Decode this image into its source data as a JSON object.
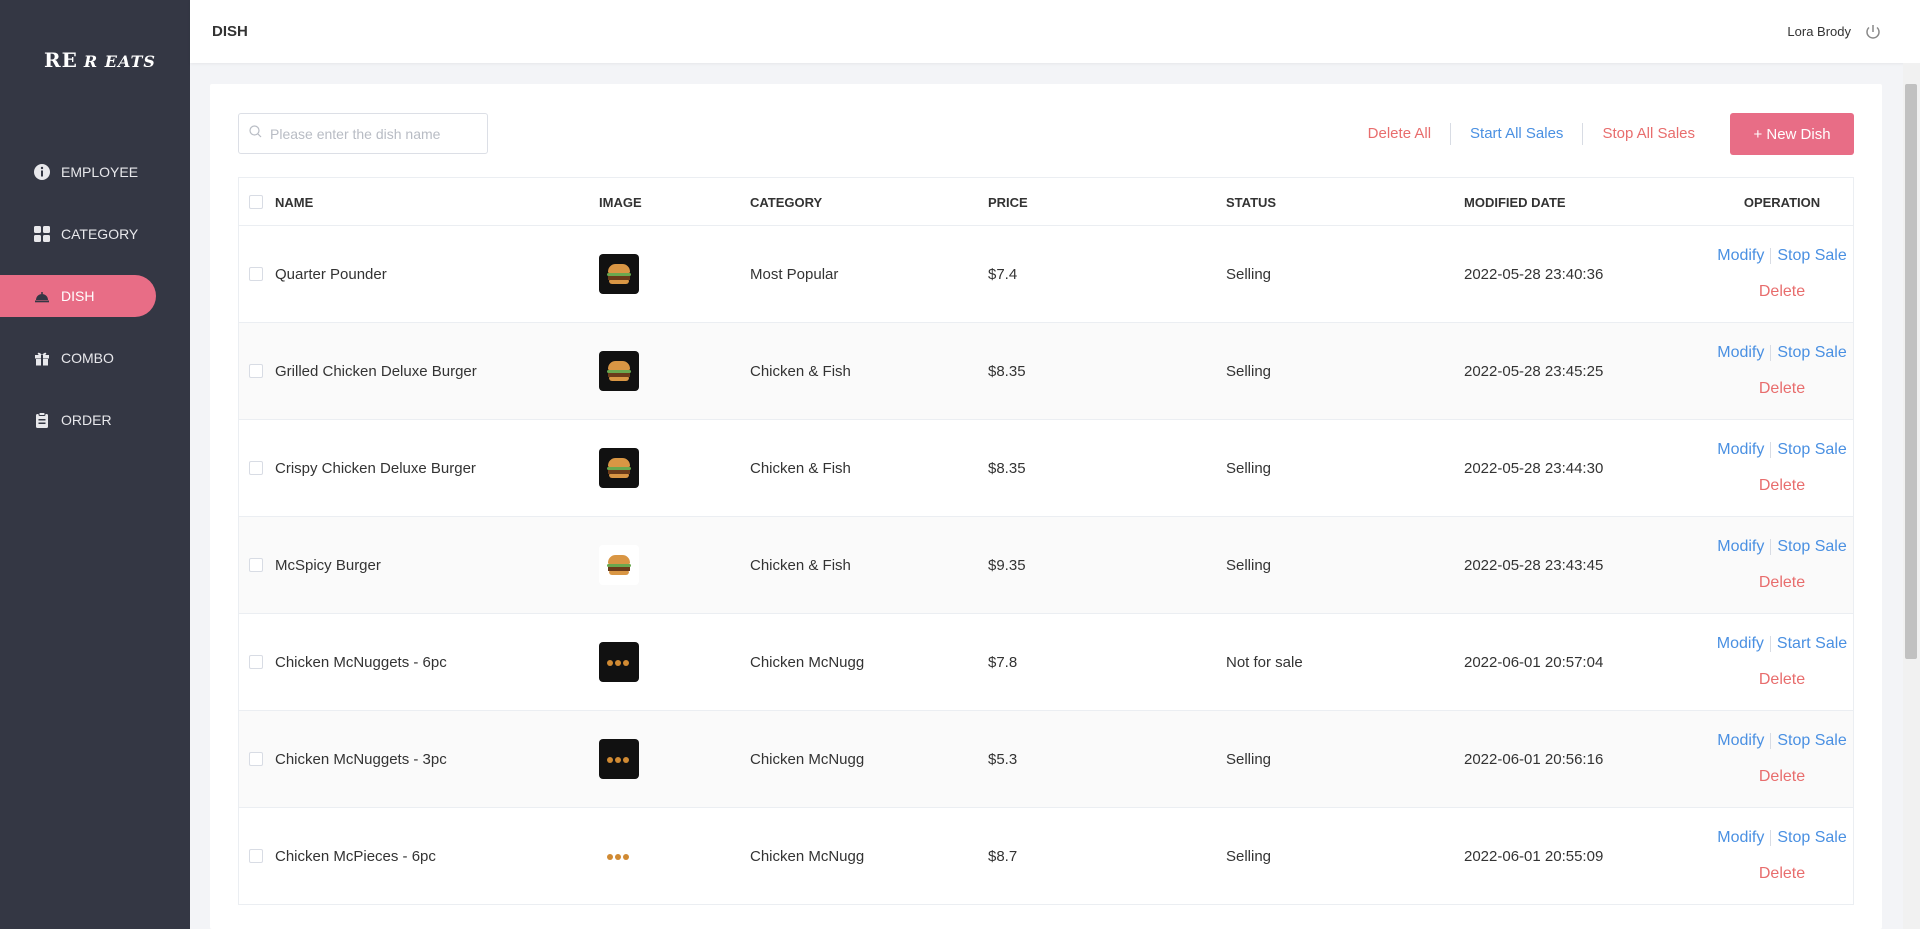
{
  "app": {
    "logo_main": "RE",
    "logo_sub": "R EATS"
  },
  "nav": {
    "items": [
      {
        "label": "EMPLOYEE",
        "icon": "info-icon",
        "active": false
      },
      {
        "label": "CATEGORY",
        "icon": "grid-icon",
        "active": false
      },
      {
        "label": "DISH",
        "icon": "dish-cloche-icon",
        "active": true
      },
      {
        "label": "COMBO",
        "icon": "gift-icon",
        "active": false
      },
      {
        "label": "ORDER",
        "icon": "clipboard-icon",
        "active": false
      }
    ]
  },
  "header": {
    "title": "DISH",
    "user_name": "Lora Brody"
  },
  "search": {
    "placeholder": "Please enter the dish name",
    "value": ""
  },
  "toolbar": {
    "delete_all": "Delete All",
    "start_all": "Start All Sales",
    "stop_all": "Stop All Sales",
    "new_dish": "+ New Dish"
  },
  "table": {
    "headers": {
      "name": "NAME",
      "image": "IMAGE",
      "category": "CATEGORY",
      "price": "PRICE",
      "status": "STATUS",
      "modified": "MODIFIED DATE",
      "operation": "OPERATION"
    },
    "rows": [
      {
        "name": "Quarter Pounder",
        "category": "Most Popular",
        "price": "$7.4",
        "status": "Selling",
        "date": "2022-05-28 23:40:36",
        "modify": "Modify",
        "toggle": "Stop Sale",
        "delete": "Delete",
        "img": "burger-dark"
      },
      {
        "name": "Grilled Chicken Deluxe Burger",
        "category": "Chicken & Fish",
        "price": "$8.35",
        "status": "Selling",
        "date": "2022-05-28 23:45:25",
        "modify": "Modify",
        "toggle": "Stop Sale",
        "delete": "Delete",
        "img": "burger-dark"
      },
      {
        "name": "Crispy Chicken Deluxe Burger",
        "category": "Chicken & Fish",
        "price": "$8.35",
        "status": "Selling",
        "date": "2022-05-28 23:44:30",
        "modify": "Modify",
        "toggle": "Stop Sale",
        "delete": "Delete",
        "img": "burger-dark"
      },
      {
        "name": "McSpicy Burger",
        "category": "Chicken & Fish",
        "price": "$9.35",
        "status": "Selling",
        "date": "2022-05-28 23:43:45",
        "modify": "Modify",
        "toggle": "Stop Sale",
        "delete": "Delete",
        "img": "burger-light"
      },
      {
        "name": "Chicken McNuggets - 6pc",
        "category": "Chicken McNugg",
        "price": "$7.8",
        "status": "Not for sale",
        "date": "2022-06-01 20:57:04",
        "modify": "Modify",
        "toggle": "Start Sale",
        "delete": "Delete",
        "img": "nuggets-dark"
      },
      {
        "name": "Chicken McNuggets - 3pc",
        "category": "Chicken McNugg",
        "price": "$5.3",
        "status": "Selling",
        "date": "2022-06-01 20:56:16",
        "modify": "Modify",
        "toggle": "Stop Sale",
        "delete": "Delete",
        "img": "nuggets-dark"
      },
      {
        "name": "Chicken McPieces - 6pc",
        "category": "Chicken McNugg",
        "price": "$8.7",
        "status": "Selling",
        "date": "2022-06-01 20:55:09",
        "modify": "Modify",
        "toggle": "Stop Sale",
        "delete": "Delete",
        "img": "nuggets-light"
      }
    ]
  },
  "colors": {
    "sidebar": "#343744",
    "accent": "#e86d86",
    "link_blue": "#4a90e2",
    "link_red": "#e86d6d"
  }
}
